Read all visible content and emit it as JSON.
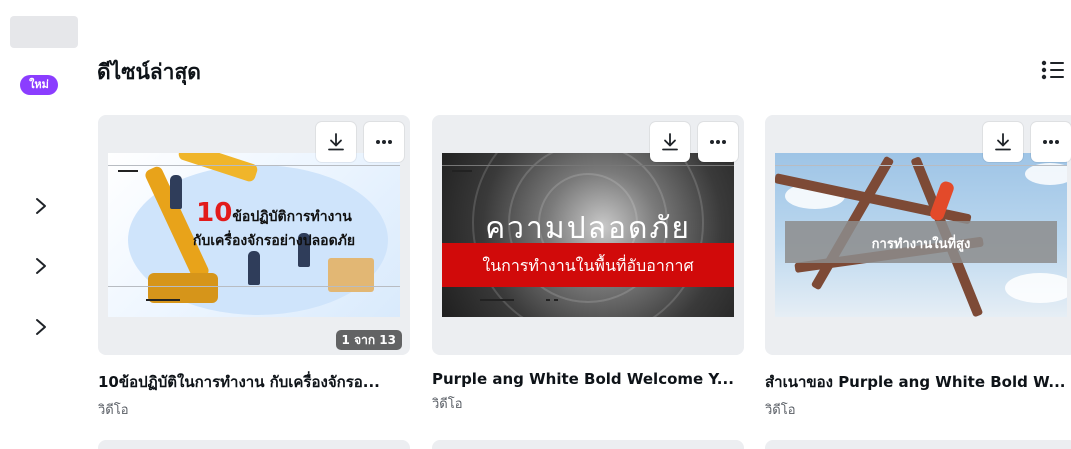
{
  "sidebar": {
    "new_badge": "ใหม่",
    "icons": [
      "chevron-right-icon",
      "chevron-right-icon",
      "chevron-right-icon"
    ]
  },
  "section": {
    "title": "ดีไซน์ล่าสุด",
    "view_icon": "list-view-icon"
  },
  "cards": [
    {
      "title": "10ข้อปฏิบัติในการทำงาน กับเครื่องจักรอ...",
      "type": "วิดีโอ",
      "page_count": "1 จาก 13",
      "thumbnail": {
        "number": "10",
        "line1": "ข้อปฏิบัติการทำงาน",
        "line2": "กับเครื่องจักรอย่างปลอดภัย"
      }
    },
    {
      "title": "Purple ang White Bold Welcome Y...",
      "type": "วิดีโอ",
      "thumbnail": {
        "headline": "ความปลอดภัย",
        "band_text": "ในการทำงานในพื้นที่อับอากาศ"
      }
    },
    {
      "title": "สำเนาของ Purple ang White Bold W...",
      "type": "วิดีโอ",
      "thumbnail": {
        "label": "การทำงานในที่สูง"
      }
    }
  ],
  "colors": {
    "accent": "#8b3dff",
    "red_band": "#d10a0a",
    "text": "#0e1318"
  }
}
